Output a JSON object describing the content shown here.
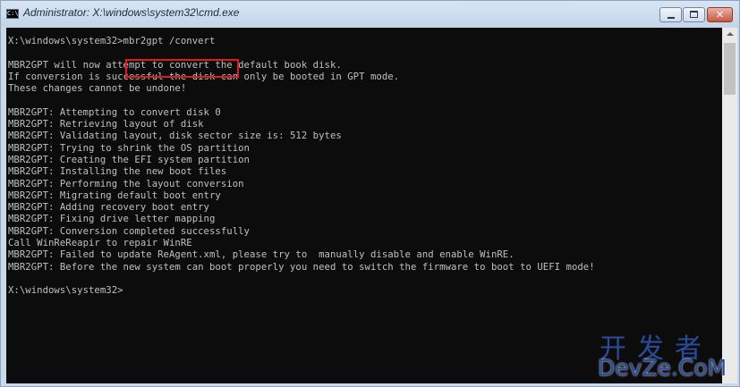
{
  "window": {
    "title": "Administrator: X:\\windows\\system32\\cmd.exe",
    "icon_text": "C:\\",
    "controls": {
      "minimize": "minimize-icon",
      "maximize": "maximize-icon",
      "close": "✕"
    }
  },
  "console": {
    "lines": [
      "X:\\windows\\system32>mbr2gpt /convert",
      "",
      "MBR2GPT will now attempt to convert the default book disk.",
      "If conversion is successful the disk can only be booted in GPT mode.",
      "These changes cannot be undone!",
      "",
      "MBR2GPT: Attempting to convert disk 0",
      "MBR2GPT: Retrieving layout of disk",
      "MBR2GPT: Validating layout, disk sector size is: 512 bytes",
      "MBR2GPT: Trying to shrink the OS partition",
      "MBR2GPT: Creating the EFI system partition",
      "MBR2GPT: Installing the new boot files",
      "MBR2GPT: Performing the layout conversion",
      "MBR2GPT: Migrating default boot entry",
      "MBR2GPT: Adding recovery boot entry",
      "MBR2GPT: Fixing drive letter mapping",
      "MBR2GPT: Conversion completed successfully",
      "Call WinReReapir to repair WinRE",
      "MBR2GPT: Failed to update ReAgent.xml, please try to  manually disable and enable WinRE.",
      "MBR2GPT: Before the new system can boot properly you need to switch the firmware to boot to UEFI mode!",
      "",
      "X:\\windows\\system32>"
    ],
    "highlighted_command": "mbr2gpt /convert",
    "highlight_color": "#e3191c",
    "background": "#0c0c0c",
    "text_color": "#c0c0c0"
  },
  "watermark": {
    "cn": "开发者",
    "en": "DevZe.CoM",
    "color": "#2a4b99"
  }
}
